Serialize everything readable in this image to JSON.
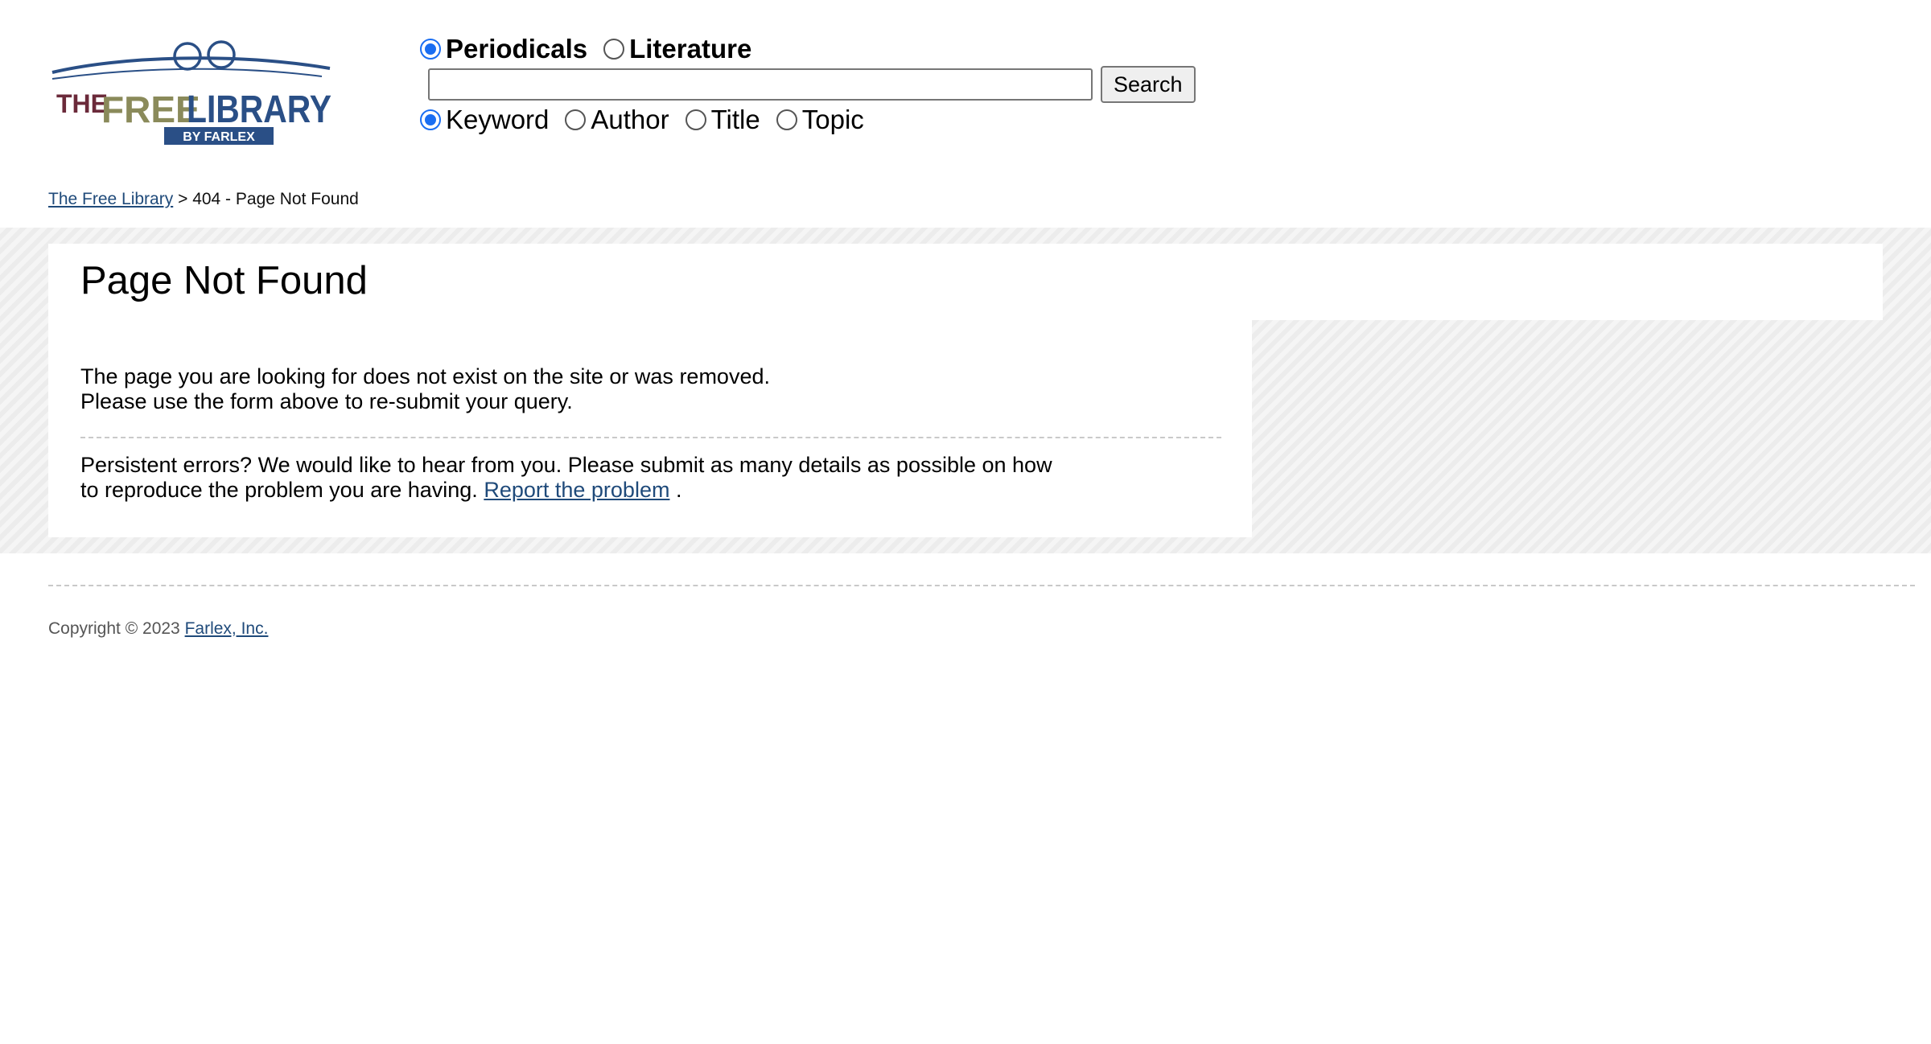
{
  "logo": {
    "word_the": "THE",
    "word_free": "FREE",
    "word_library": "LIBRARY",
    "byline": "BY FARLEX"
  },
  "search": {
    "scope_options": [
      {
        "label": "Periodicals",
        "checked": true
      },
      {
        "label": "Literature",
        "checked": false
      }
    ],
    "query_value": "",
    "button_label": "Search",
    "field_options": [
      {
        "label": "Keyword",
        "checked": true
      },
      {
        "label": "Author",
        "checked": false
      },
      {
        "label": "Title",
        "checked": false
      },
      {
        "label": "Topic",
        "checked": false
      }
    ]
  },
  "breadcrumb": {
    "home_link": "The Free Library",
    "separator": ">",
    "current": "404 - Page Not Found"
  },
  "main": {
    "title": "Page Not Found",
    "line1": "The page you are looking for does not exist on the site or was removed.",
    "line2": "Please use the form above to re-submit your query.",
    "persistent_line1": "Persistent errors? We would like to hear from you. Please submit as many details as possible on how",
    "persistent_line2_prefix": "to reproduce the problem you are having.",
    "report_link": "Report the problem",
    "persistent_line2_suffix": "."
  },
  "footer": {
    "copyright_text": "Copyright © 2023",
    "company_link": "Farlex, Inc."
  },
  "colors": {
    "link": "#1f4a7a",
    "radio_accent": "#1a6ef2",
    "logo_maroon": "#6b2a3a",
    "logo_olive": "#8a8a5a",
    "logo_navy": "#2a4f86"
  }
}
